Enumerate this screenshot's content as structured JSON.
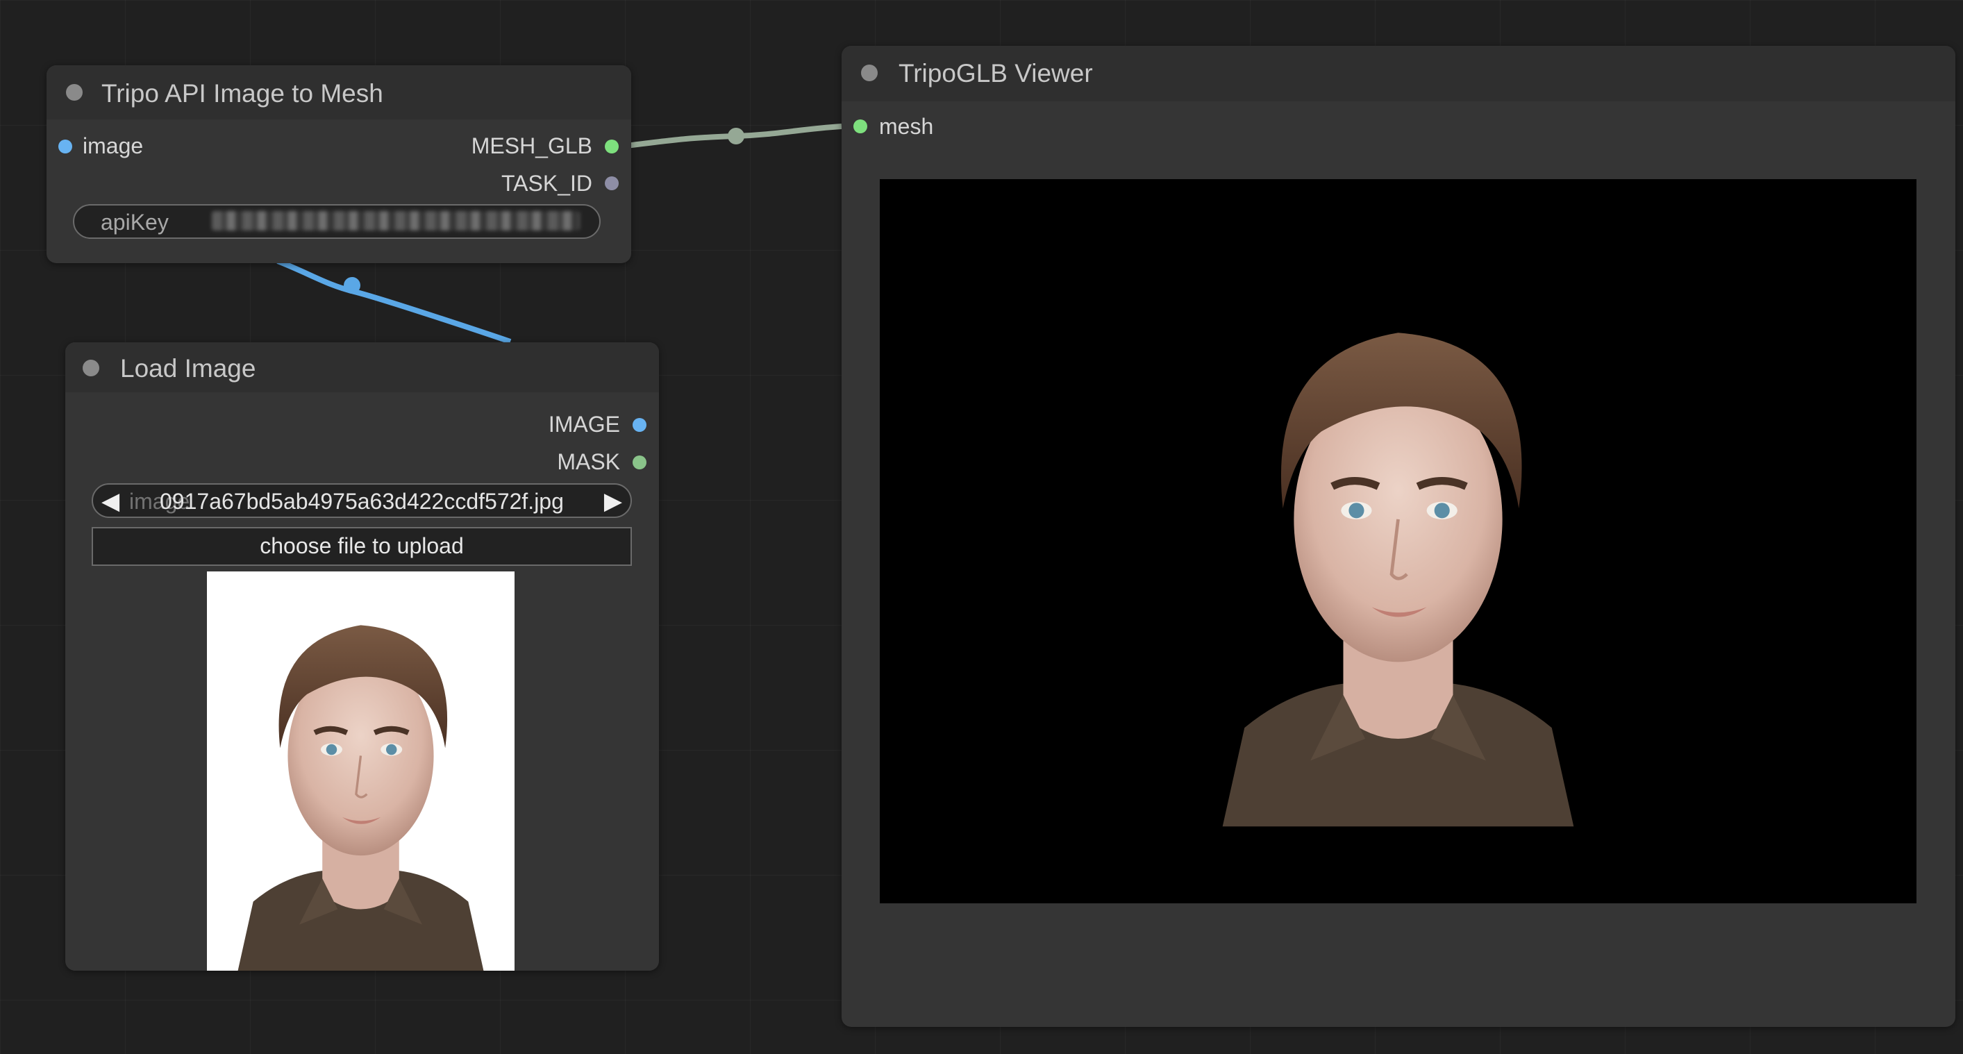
{
  "colors": {
    "canvas": "#202020",
    "node_body": "#353535",
    "node_title": "#2f2f2f",
    "image_link": "#5aa7e6",
    "mesh_link": "#95a895",
    "image_slot": "#68b3f2",
    "mesh_slot": "#7ee07e",
    "task_slot": "#8e8ea6"
  },
  "nodes": {
    "tripo_api": {
      "title": "Tripo API Image to Mesh",
      "input_image": "image",
      "output_mesh": "MESH_GLB",
      "output_task": "TASK_ID",
      "api_key_label": "apiKey"
    },
    "load_image": {
      "title": "Load Image",
      "output_image": "IMAGE",
      "output_mask": "MASK",
      "image_label": "image",
      "image_value": "0917a67bd5ab4975a63d422ccdf572f.jpg",
      "upload_label": "choose file to upload"
    },
    "glb_viewer": {
      "title": "TripoGLB Viewer",
      "input_mesh": "mesh"
    }
  },
  "icons": {
    "prev": "◀",
    "next": "▶"
  }
}
